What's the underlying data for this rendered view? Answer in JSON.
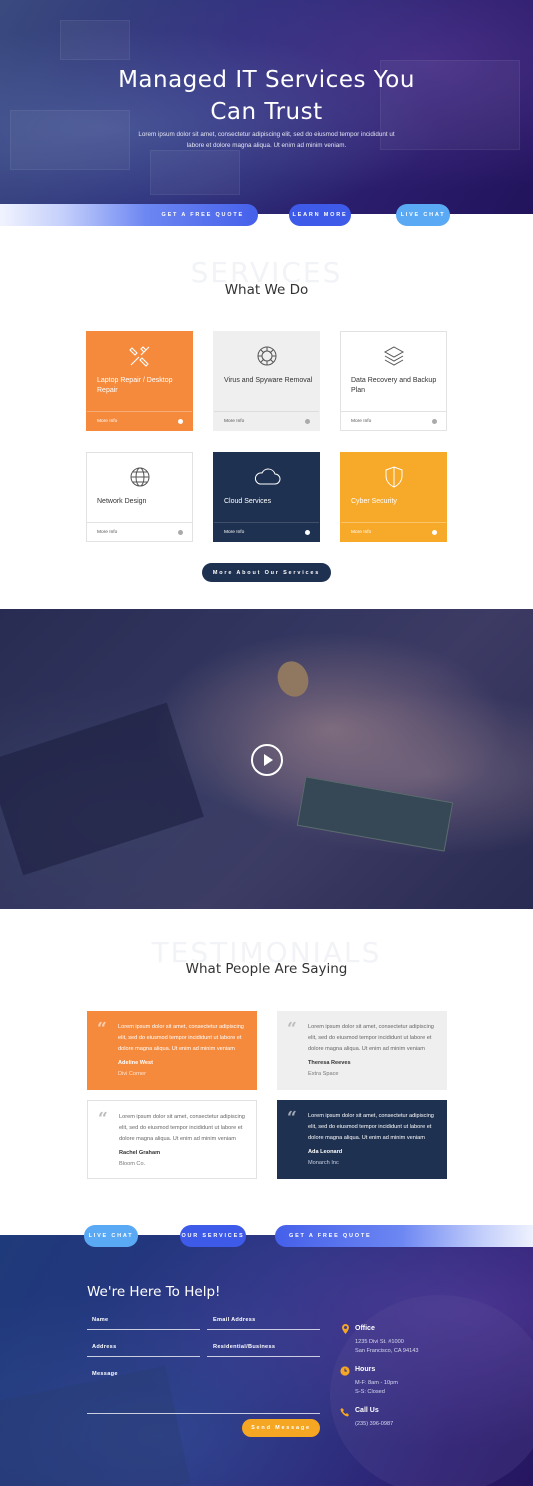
{
  "hero": {
    "title_line1": "Managed IT Services You",
    "title_line2": "Can Trust",
    "text": "Lorem ipsum dolor sit amet, consectetur adipiscing elit, sed do eiusmod tempor incididunt ut labore et dolore magna aliqua. Ut enim ad minim veniam."
  },
  "cta_top": {
    "quote": "Get a Free Quote",
    "learn": "Learn More",
    "live": "Live Chat"
  },
  "services": {
    "ghost": "SERVICES",
    "title": "What We Do",
    "cards": [
      {
        "title": "Laptop Repair / Desktop Repair",
        "more": "More Info",
        "icon": "tools-icon",
        "bg": "#f58a3d"
      },
      {
        "title": "Virus and Spyware Removal",
        "more": "More Info",
        "icon": "virus-icon",
        "bg": "#efefef"
      },
      {
        "title": "Data Recovery and Backup Plan",
        "more": "More Info",
        "icon": "layers-icon",
        "bg": "#ffffff"
      },
      {
        "title": "Network Design",
        "more": "More Info",
        "icon": "globe-icon",
        "bg": "#ffffff"
      },
      {
        "title": "Cloud Services",
        "more": "More Info",
        "icon": "cloud-icon",
        "bg": "#1f3150"
      },
      {
        "title": "Cyber Security",
        "more": "More Info",
        "icon": "shield-icon",
        "bg": "#f7a929"
      }
    ],
    "button": "More About Our Services"
  },
  "video": {
    "icon": "play-icon"
  },
  "testimonials": {
    "ghost": "TESTIMONIALS",
    "title": "What People Are Saying",
    "items": [
      {
        "text": "Lorem ipsum dolor sit amet, consectetur adipiscing elit, sed do eiusmod tempor incididunt ut labore et dolore magna aliqua. Ut enim ad minim veniam",
        "name": "Adeline West",
        "company": "Divi Corner"
      },
      {
        "text": "Lorem ipsum dolor sit amet, consectetur adipiscing elit, sed do eiusmod tempor incididunt ut labore et dolore magna aliqua. Ut enim ad minim veniam",
        "name": "Theresa Reeves",
        "company": "Extra Space"
      },
      {
        "text": "Lorem ipsum dolor sit amet, consectetur adipiscing elit, sed do eiusmod tempor incididunt ut labore et dolore magna aliqua. Ut enim ad minim veniam",
        "name": "Rachel Graham",
        "company": "Bloom Co."
      },
      {
        "text": "Lorem ipsum dolor sit amet, consectetur adipiscing elit, sed do eiusmod tempor incididunt ut labore et dolore magna aliqua. Ut enim ad minim veniam",
        "name": "Ada Leonard",
        "company": "Monarch Inc"
      }
    ]
  },
  "cta_bottom": {
    "live": "Live Chat",
    "services": "Our Services",
    "quote": "Get a Free Quote"
  },
  "contact": {
    "title": "We're Here To Help!",
    "fields": {
      "name": "Name",
      "email": "Email Address",
      "address": "Address",
      "type": "Residential/Business",
      "message": "Message"
    },
    "send": "Send Message",
    "office_h": "Office",
    "office_1": "1235 Divi St. #1000",
    "office_2": "San Francisco, CA 94143",
    "hours_h": "Hours",
    "hours_1": "M-F: 8am - 10pm",
    "hours_2": "S-S: Closed",
    "call_h": "Call Us",
    "call_1": "(235) 396-0987"
  },
  "colors": {
    "orange": "#f58a3d",
    "navy": "#1f3150",
    "blue": "#3d5ae8",
    "sky": "#5aa9f5",
    "amber": "#f5a623"
  }
}
